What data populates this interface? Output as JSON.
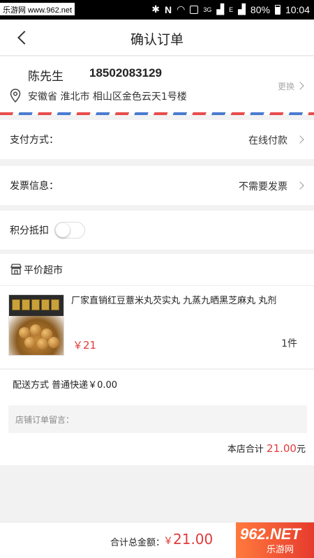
{
  "status_bar": {
    "watermark": "乐游网 www.962.net",
    "net_label": "3G",
    "signal_e": "E",
    "battery": "80%",
    "time": "10:04"
  },
  "nav": {
    "title": "确认订单"
  },
  "address": {
    "name": "陈先生",
    "phone": "18502083129",
    "text": "安徽省 淮北市 相山区金色云天1号楼",
    "change_label": "更换"
  },
  "payment": {
    "label": "支付方式：",
    "value": "在线付款"
  },
  "invoice": {
    "label": "发票信息：",
    "value": "不需要发票"
  },
  "points": {
    "label": "积分抵扣",
    "enabled": false
  },
  "store": {
    "name": "平价超市"
  },
  "product": {
    "title": "厂家直销红豆薏米丸芡实丸 九蒸九晒黑芝麻丸 丸剂",
    "price": "￥21",
    "quantity": "1件"
  },
  "delivery": {
    "text": "配送方式 普通快递￥0.00"
  },
  "message": {
    "placeholder": "店铺订单留言："
  },
  "store_total": {
    "label": "本店合计",
    "amount": "21.00",
    "unit": "元"
  },
  "footer": {
    "total_label": "合计总金额：",
    "currency": "￥",
    "total_amount": "21.00",
    "logo_big": "962.NET",
    "logo_small": "乐游网"
  },
  "colors": {
    "accent": "#e23a3a",
    "background": "#f2f2f2"
  }
}
